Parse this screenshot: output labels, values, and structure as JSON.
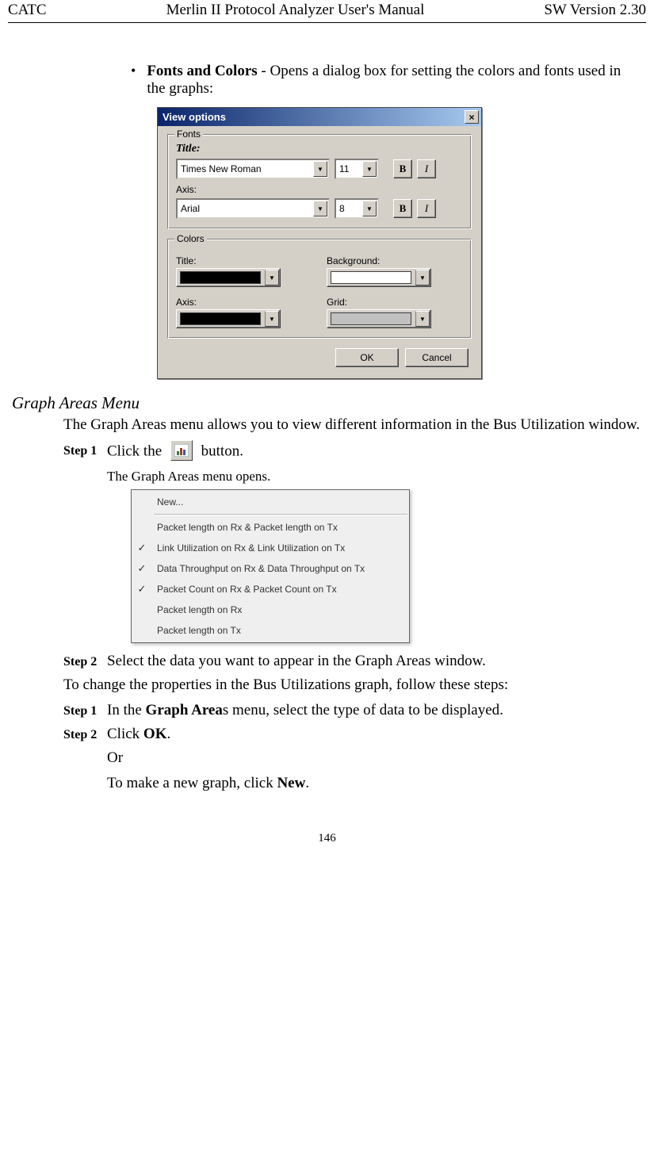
{
  "header": {
    "left": "CATC",
    "center": "Merlin II Protocol Analyzer User's Manual",
    "right": "SW Version 2.30"
  },
  "intro": {
    "bullet_bold": "Fonts and Colors",
    "bullet_rest": " - Opens a dialog box for setting the colors and fonts used in the graphs:"
  },
  "dialog": {
    "title": "View options",
    "close_glyph": "×",
    "group_fonts": "Fonts",
    "group_colors": "Colors",
    "label_title": "Title:",
    "label_axis": "Axis:",
    "label_title2": "Title:",
    "label_background": "Background:",
    "label_axis2": "Axis:",
    "label_grid": "Grid:",
    "font_title": "Times New Roman",
    "font_title_size": "11",
    "font_axis": "Arial",
    "font_axis_size": "8",
    "btn_bold": "B",
    "btn_italic": "I",
    "colors": {
      "title": "#000000",
      "background": "#ffffff",
      "axis": "#000000",
      "grid": "#c0c0c0"
    },
    "btn_ok": "OK",
    "btn_cancel": "Cancel",
    "arrow": "▼"
  },
  "section_heading": "Graph Areas Menu",
  "section_intro": "The Graph Areas menu allows you to view different information in the Bus Utilization window.",
  "step1_label": "Step 1",
  "step1_pre": "Click the ",
  "step1_post": " button.",
  "step1_caption": "The Graph Areas menu opens.",
  "menu": {
    "items": [
      {
        "label": "New...",
        "checked": false,
        "sep_after": true
      },
      {
        "label": "Packet length on Rx & Packet length on Tx",
        "checked": false
      },
      {
        "label": "Link Utilization on Rx & Link Utilization on Tx",
        "checked": true
      },
      {
        "label": "Data Throughput on Rx & Data Throughput on Tx",
        "checked": true
      },
      {
        "label": "Packet Count on Rx & Packet Count on Tx",
        "checked": true
      },
      {
        "label": "Packet length on Rx",
        "checked": false
      },
      {
        "label": "Packet length on Tx",
        "checked": false
      }
    ],
    "check_glyph": "✓"
  },
  "step2_label": "Step 2",
  "step2_text": "Select the data you want to appear in the Graph Areas window.",
  "para_change": "To change the properties in the Bus Utilizations graph, follow these steps:",
  "stepB1_label": "Step 1",
  "stepB1_pre": "In the ",
  "stepB1_bold": "Graph Area",
  "stepB1_post": "s menu, select the type of data to be displayed.",
  "stepB2_label": "Step 2",
  "stepB2_pre": "Click ",
  "stepB2_bold": "OK",
  "stepB2_post": ".",
  "or_text": "Or",
  "new_pre": "To make a new graph, click ",
  "new_bold": "New",
  "new_post": ".",
  "page_number": "146"
}
